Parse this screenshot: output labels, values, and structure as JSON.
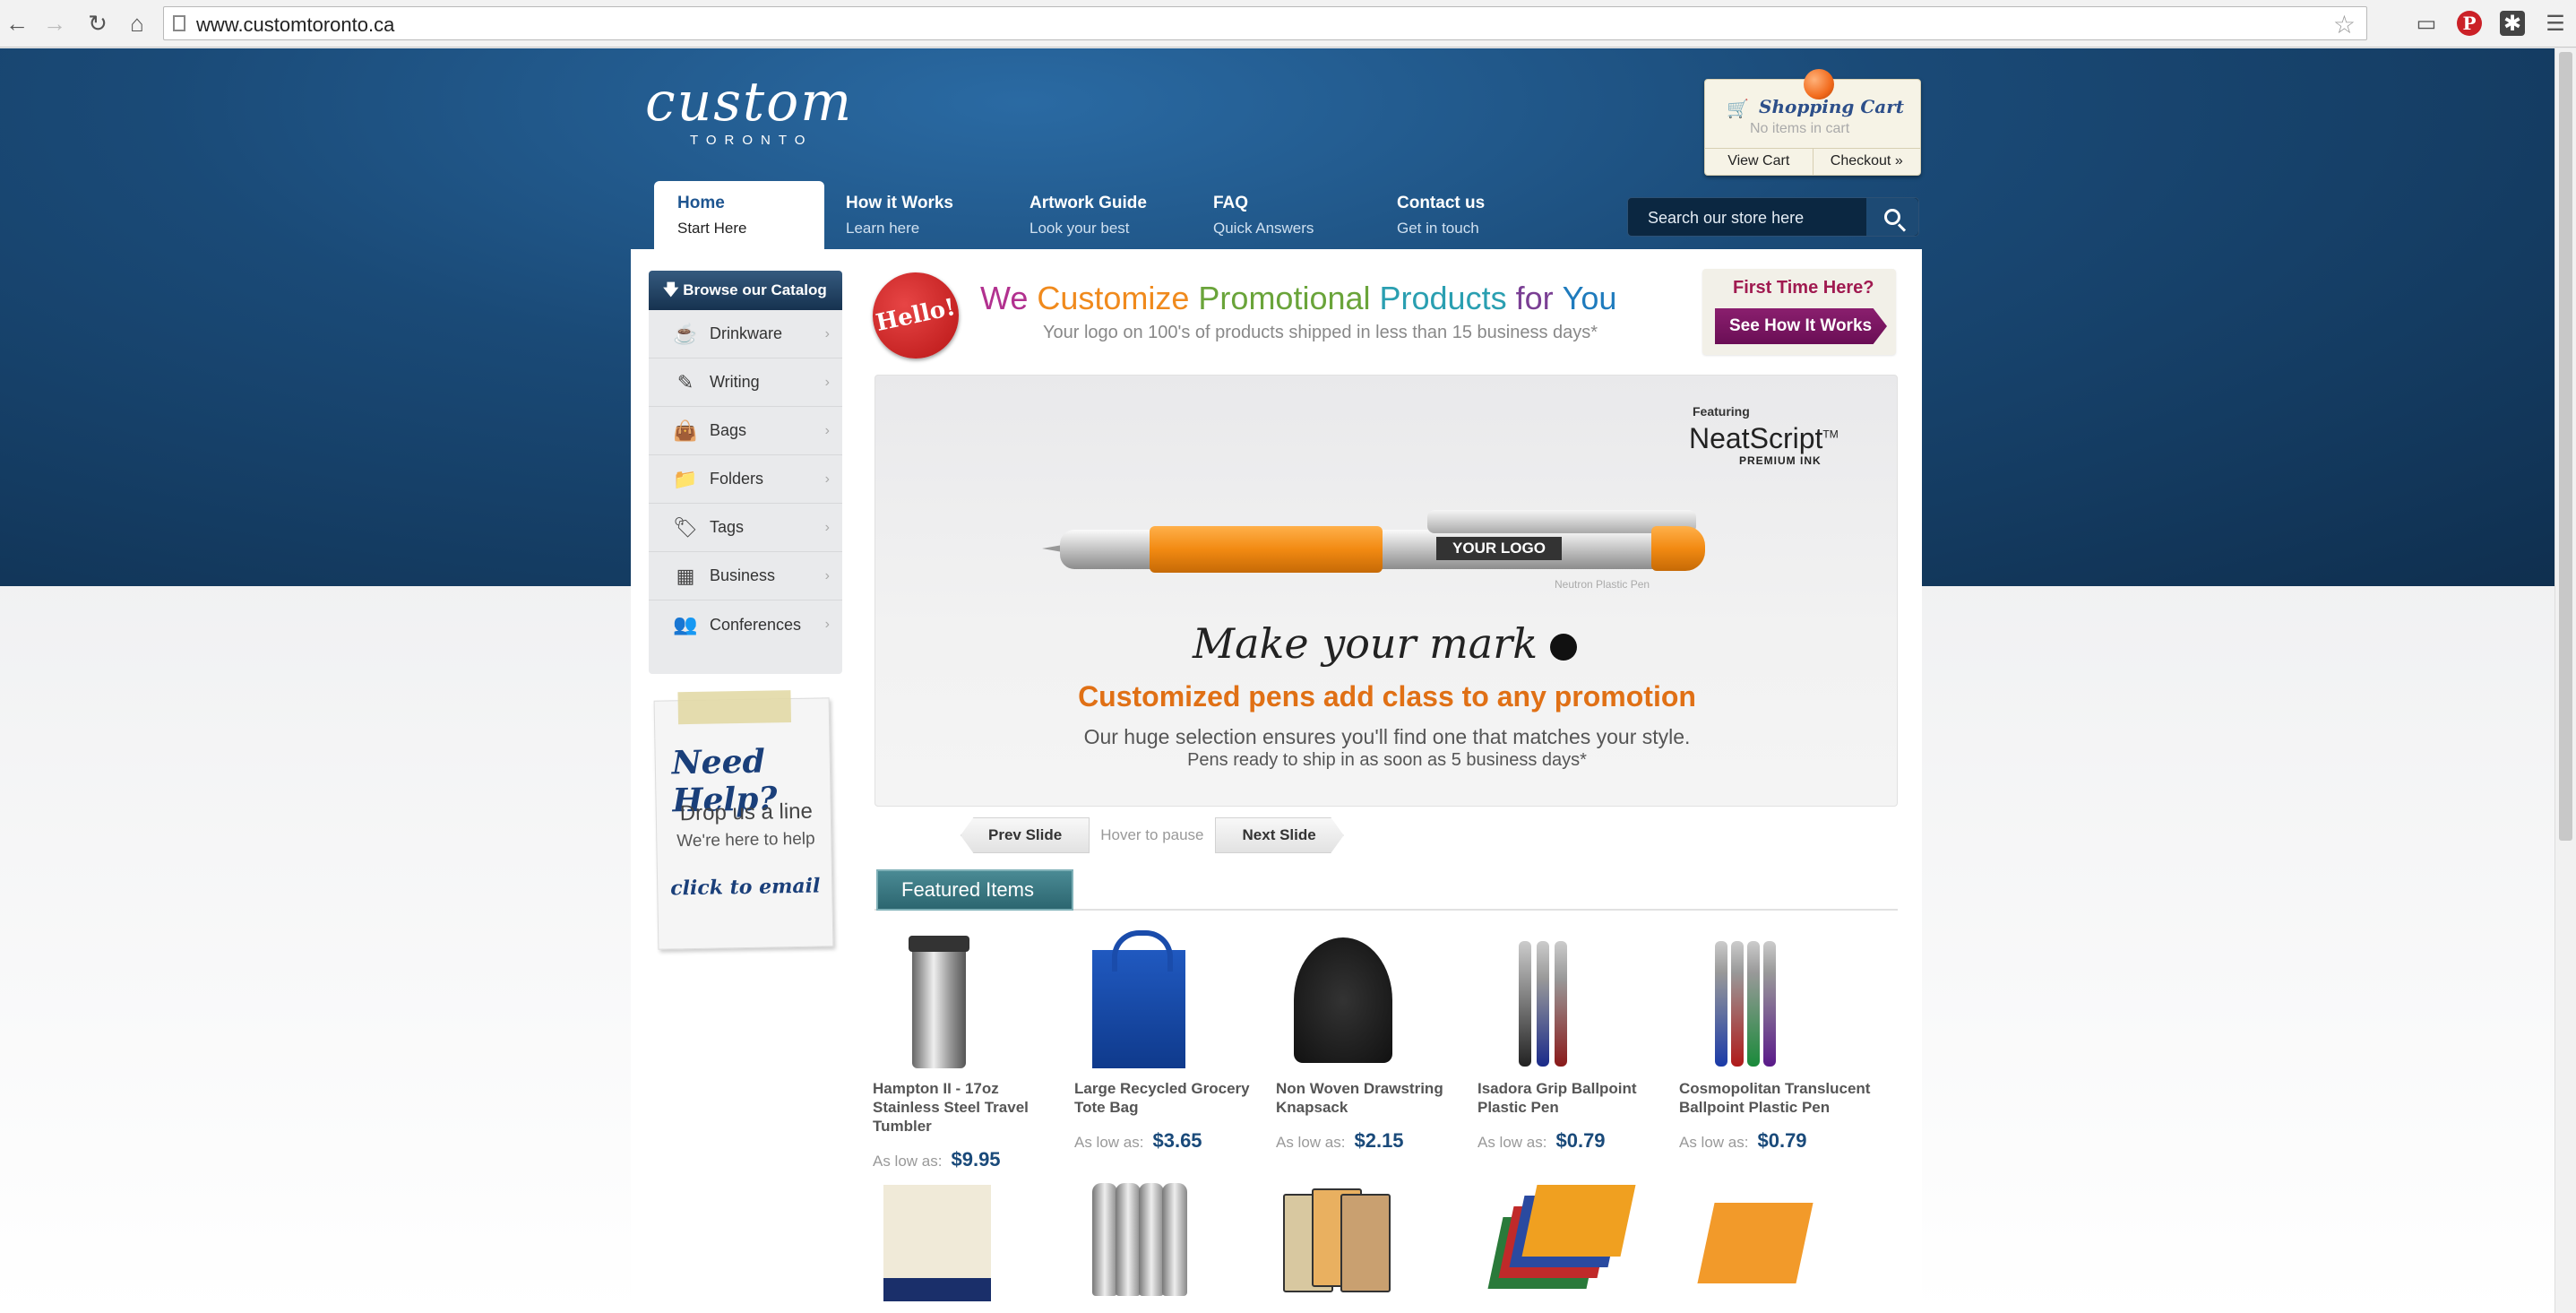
{
  "browser": {
    "url": "www.customtoronto.ca"
  },
  "logo": {
    "main": "custom",
    "sub": "TORONTO"
  },
  "cart": {
    "title": "Shopping Cart",
    "empty": "No items in cart",
    "view": "View Cart",
    "checkout": "Checkout »"
  },
  "menu": [
    {
      "title": "Home",
      "sub": "Start Here"
    },
    {
      "title": "How it Works",
      "sub": "Learn here"
    },
    {
      "title": "Artwork Guide",
      "sub": "Look your best"
    },
    {
      "title": "FAQ",
      "sub": "Quick Answers"
    },
    {
      "title": "Contact us",
      "sub": "Get in touch"
    }
  ],
  "search": {
    "placeholder": "Search our store here"
  },
  "catalog": {
    "header": "Browse our Catalog",
    "items": [
      "Drinkware",
      "Writing",
      "Bags",
      "Folders",
      "Tags",
      "Business",
      "Conferences"
    ]
  },
  "help": {
    "title": "Need Help?",
    "line1": "Drop us a line",
    "line2": "We're here to help",
    "link": "click to email"
  },
  "hello": {
    "badge": "Hello!",
    "words": [
      {
        "text": "We",
        "color": "#b2318f"
      },
      {
        "text": "Customize",
        "color": "#f08a1d"
      },
      {
        "text": "Promotional",
        "color": "#6aa43a"
      },
      {
        "text": "Products",
        "color": "#2a9fb1"
      },
      {
        "text": "for",
        "color": "#7a3f94"
      },
      {
        "text": "You",
        "color": "#1f7bbd"
      }
    ],
    "subtitle": "Your logo on 100's of products shipped in less than 15 business days*"
  },
  "first": {
    "question": "First Time Here?",
    "button": "See How It Works"
  },
  "slide": {
    "featuring": "Featuring",
    "brand": "NeatScript",
    "tm": "TM",
    "premium": "PREMIUM INK",
    "logo_text": "YOUR LOGO",
    "pen_name": "Neutron Plastic Pen",
    "tagline": "Make your mark",
    "headline": "Customized pens add class to any promotion",
    "line1": "Our huge selection ensures you'll find one that matches your style.",
    "line2": "Pens ready to ship in as soon as 5 business days*"
  },
  "slider": {
    "prev": "Prev Slide",
    "hover": "Hover to pause",
    "next": "Next Slide"
  },
  "featured": {
    "title": "Featured Items",
    "price_prefix": "As low as:",
    "items": [
      {
        "name": "Hampton II - 17oz Stainless Steel Travel Tumbler",
        "price": "$9.95"
      },
      {
        "name": "Large Recycled Grocery Tote Bag",
        "price": "$3.65"
      },
      {
        "name": "Non Woven Drawstring Knapsack",
        "price": "$2.15"
      },
      {
        "name": "Isadora Grip Ballpoint Plastic Pen",
        "price": "$0.79"
      },
      {
        "name": "Cosmopolitan Translucent Ballpoint Plastic Pen",
        "price": "$0.79"
      }
    ]
  }
}
